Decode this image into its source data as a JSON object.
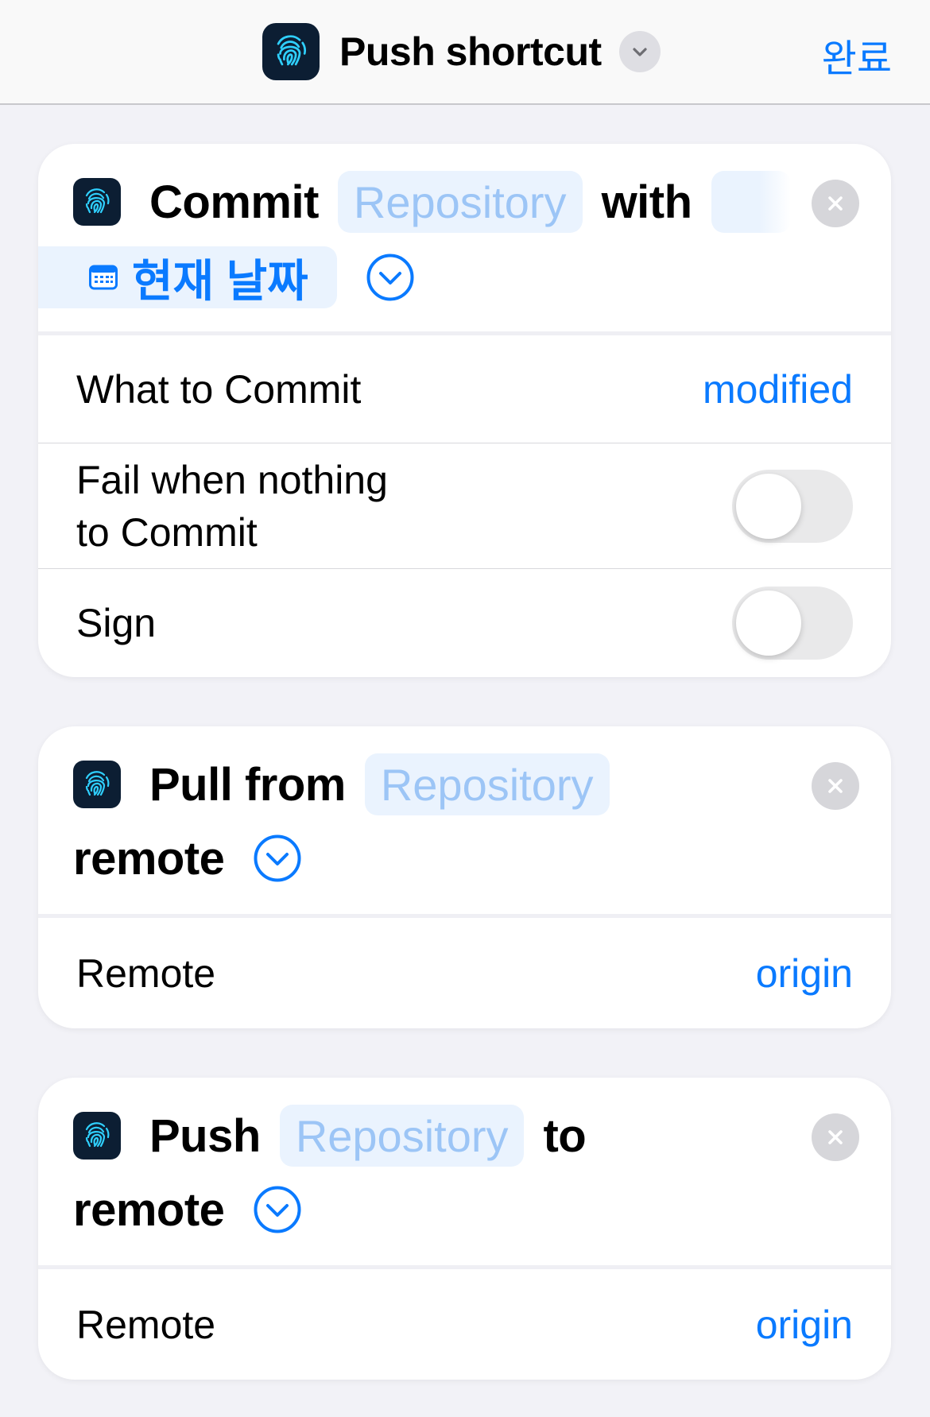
{
  "nav": {
    "title": "Push shortcut",
    "done_label": "완료"
  },
  "actions": [
    {
      "verb": "Commit",
      "repo_token": "Repository",
      "connector": "with",
      "message_token": "현재 날짜",
      "params": [
        {
          "label": "What to Commit",
          "value": "modified"
        },
        {
          "label_line1": "Fail when nothing",
          "label_line2": "to Commit",
          "toggle_on": false
        },
        {
          "label": "Sign",
          "toggle_on": false
        }
      ]
    },
    {
      "verb": "Pull from",
      "repo_token": "Repository",
      "line2": "remote",
      "params": [
        {
          "label": "Remote",
          "value": "origin"
        }
      ]
    },
    {
      "verb": "Push",
      "repo_token": "Repository",
      "connector": "to",
      "line2": "remote",
      "params": [
        {
          "label": "Remote",
          "value": "origin"
        }
      ]
    }
  ],
  "colors": {
    "accent": "#0a7aff",
    "token_bg": "#eaf3fe",
    "icon_bg": "#0c1e33",
    "icon_fg": "#2fd0ff"
  },
  "icons": {
    "app": "fingerprint-icon",
    "close": "close-icon",
    "expand": "chevron-down-circle-icon",
    "calendar": "calendar-icon"
  }
}
